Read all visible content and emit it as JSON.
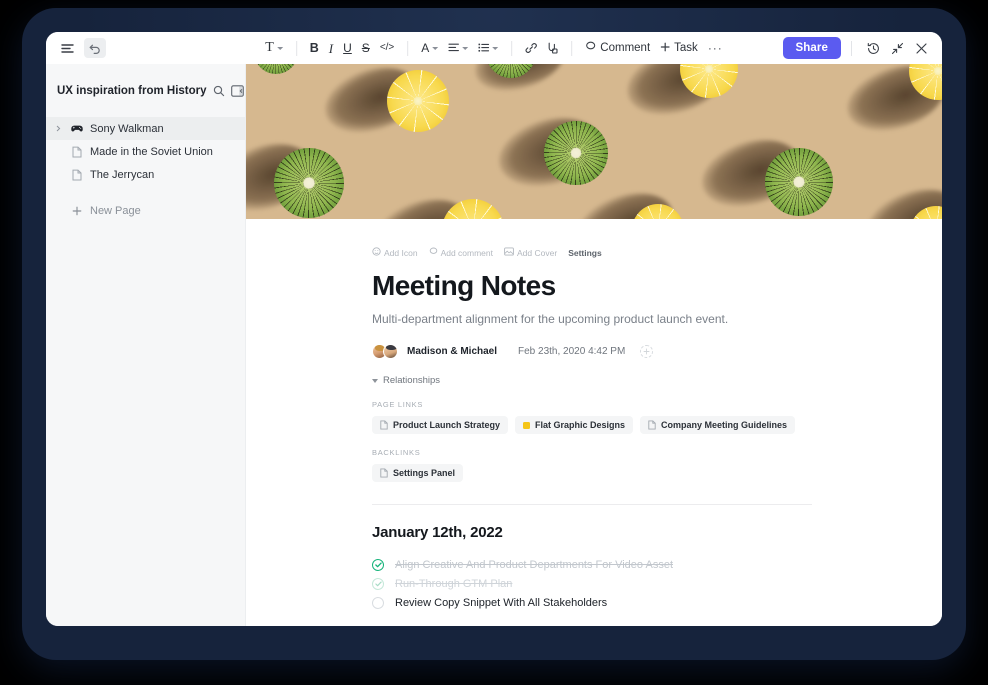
{
  "toolbar": {
    "menu_icon": "hamburger-menu-icon",
    "undo_icon": "undo-arrow-icon",
    "text_style_label": "T",
    "bold_label": "B",
    "italic_label": "I",
    "underline_label": "U",
    "strikethrough_label": "S",
    "code_label": "</>",
    "font_color_label": "A",
    "align_icon": "align-left-icon",
    "list_icon": "bulleted-list-icon",
    "link_icon": "link-icon",
    "attachment_icon": "attachment-icon",
    "comment_label": "Comment",
    "task_label": "Task",
    "more_label": "···",
    "share_label": "Share",
    "history_icon": "history-clock-icon",
    "collapse_icon": "collapse-arrows-icon",
    "close_icon": "close-x-icon"
  },
  "sidebar": {
    "title": "UX inspiration from History",
    "search_icon": "search-icon",
    "panel_icon": "toggle-panel-icon",
    "items": [
      {
        "label": "Sony Walkman",
        "icon": "game-controller-icon",
        "active": true,
        "expandable": true
      },
      {
        "label": "Made in the Soviet Union",
        "icon": "page-doc-icon",
        "active": false,
        "expandable": false
      },
      {
        "label": "The Jerrycan",
        "icon": "page-doc-icon",
        "active": false,
        "expandable": false
      }
    ],
    "new_page_label": "New Page",
    "new_page_icon": "plus-icon"
  },
  "document": {
    "banner_bg": "#d6b88f",
    "meta_actions": [
      {
        "label": "Add Icon",
        "icon": "smiley-icon",
        "emphasis": false
      },
      {
        "label": "Add comment",
        "icon": "comment-bubble-icon",
        "emphasis": false
      },
      {
        "label": "Add Cover",
        "icon": "image-icon",
        "emphasis": false
      },
      {
        "label": "Settings",
        "icon": "",
        "emphasis": true
      }
    ],
    "title": "Meeting Notes",
    "subtitle": "Multi-department alignment for the upcoming product launch event.",
    "author_name": "Madison & Michael",
    "timestamp": "Feb 23th, 2020  4:42 PM",
    "relationships_label": "Relationships",
    "page_links_label": "PAGE LINKS",
    "page_links": [
      {
        "label": "Product Launch Strategy",
        "icon": "page-doc-icon"
      },
      {
        "label": "Flat Graphic Designs",
        "icon": "yellow-square-icon",
        "color": "#f5c518"
      },
      {
        "label": "Company Meeting Guidelines",
        "icon": "page-doc-icon"
      }
    ],
    "backlinks_label": "BACKLINKS",
    "backlinks": [
      {
        "label": "Settings Panel",
        "icon": "page-doc-icon"
      }
    ],
    "date_heading": "January 12th, 2022",
    "todos": [
      {
        "label": "Align Creative And Product Departments For Video Asset",
        "state": "done"
      },
      {
        "label": "Run-Through GTM Plan",
        "state": "faded"
      },
      {
        "label": "Review Copy Snippet With All Stakeholders",
        "state": "empty"
      }
    ]
  },
  "colors": {
    "accent": "#5b5bf0",
    "check_green": "#15b37a",
    "frame": "#16233c",
    "page_bg": "#000000"
  }
}
